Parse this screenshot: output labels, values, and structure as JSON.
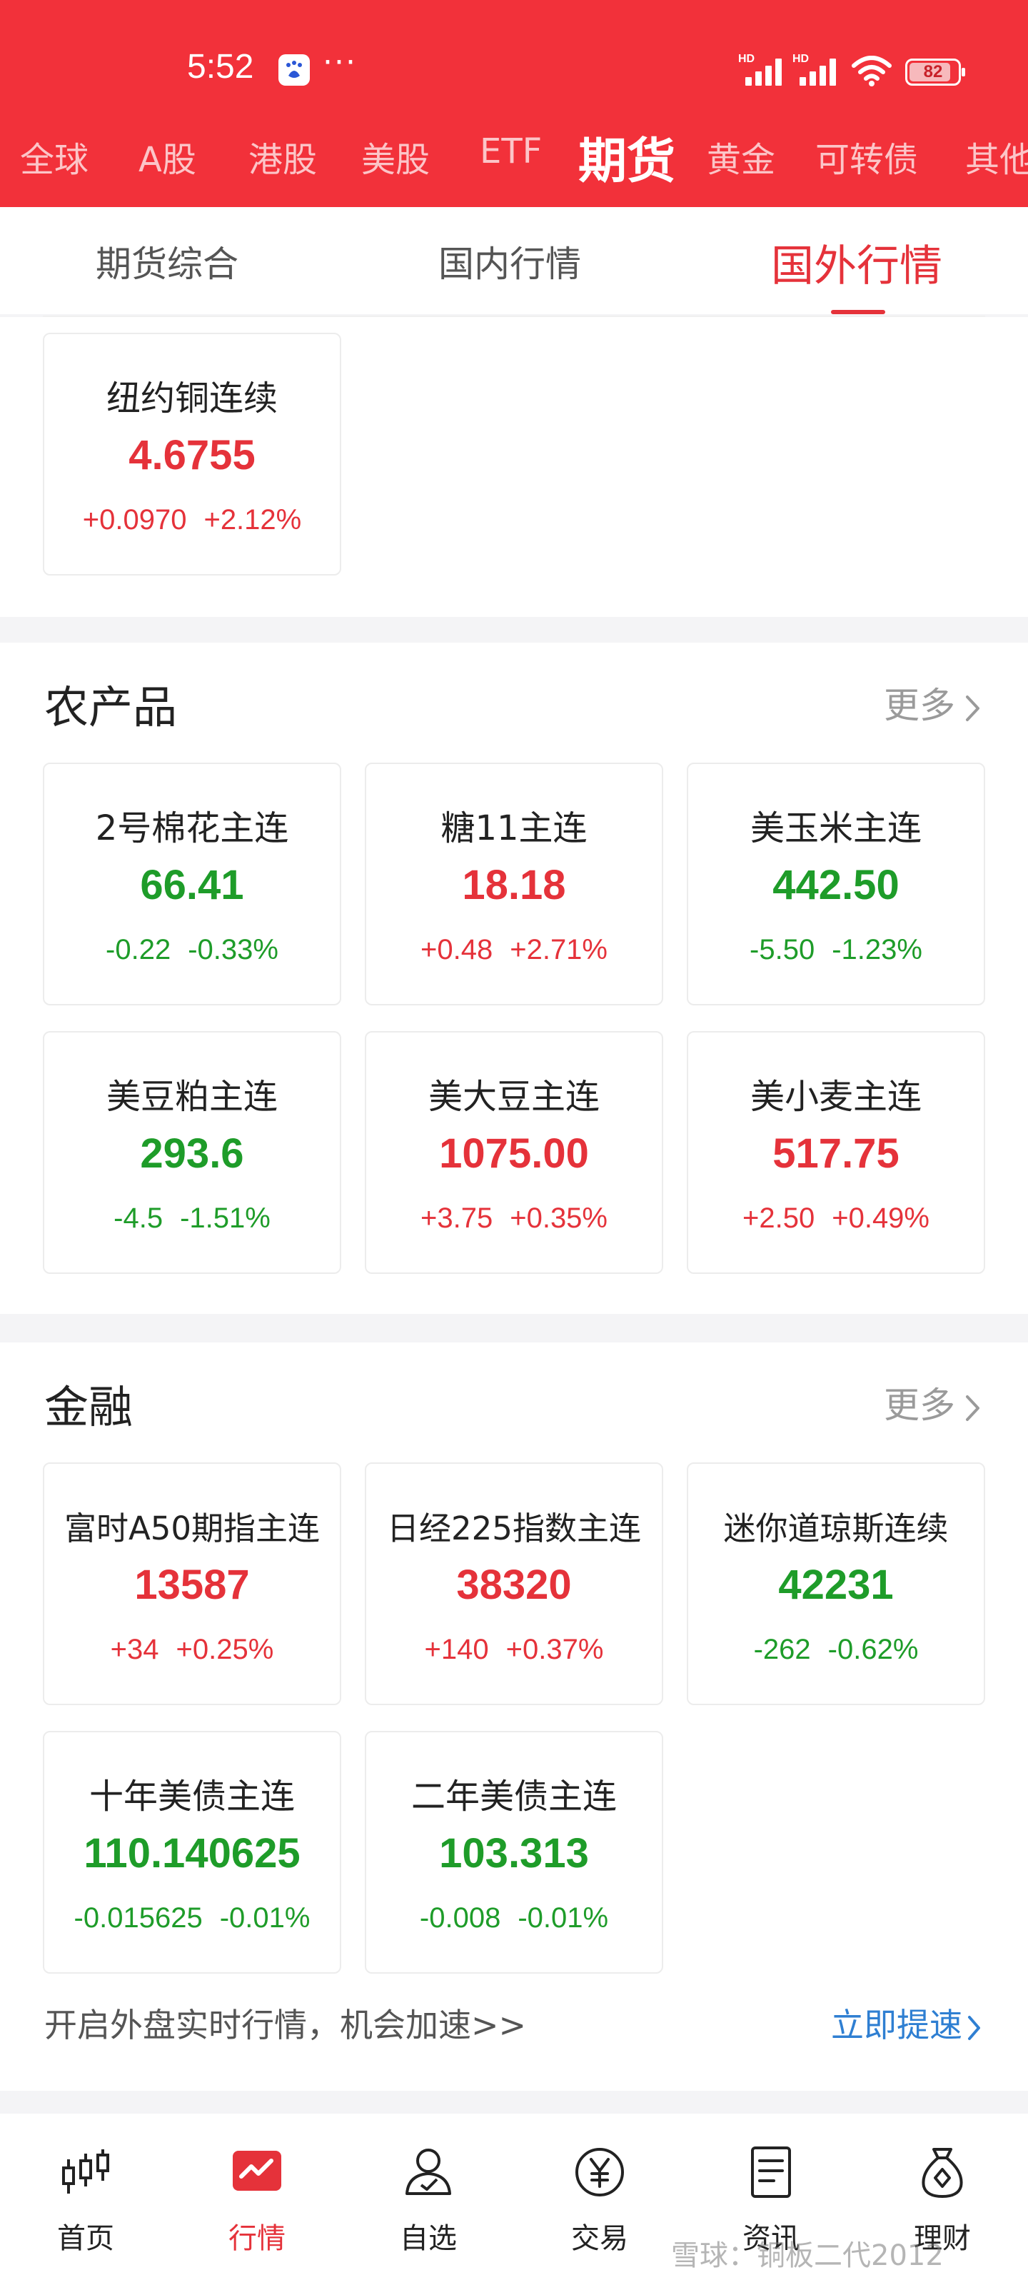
{
  "status_bar": {
    "time": "5:52",
    "more": "···",
    "signal1_label": "HD",
    "signal2_label": "HD",
    "battery": "82"
  },
  "market_tabs": [
    "全球",
    "A股",
    "港股",
    "美股",
    "ETF",
    "期货",
    "黄金",
    "可转债",
    "其他"
  ],
  "active_market_tab": "期货",
  "sub_tabs": [
    "期货综合",
    "国内行情",
    "国外行情"
  ],
  "active_sub_tab": "国外行情",
  "copper": {
    "name": "纽约铜连续",
    "price": "4.6755",
    "change": "+0.0970",
    "pct": "+2.12%",
    "trend": "up"
  },
  "agri": {
    "title": "农产品",
    "more": "更多",
    "items": [
      {
        "name": "2号棉花主连",
        "price": "66.41",
        "change": "-0.22",
        "pct": "-0.33%",
        "trend": "down"
      },
      {
        "name": "糖11主连",
        "price": "18.18",
        "change": "+0.48",
        "pct": "+2.71%",
        "trend": "up"
      },
      {
        "name": "美玉米主连",
        "price": "442.50",
        "change": "-5.50",
        "pct": "-1.23%",
        "trend": "down"
      },
      {
        "name": "美豆粕主连",
        "price": "293.6",
        "change": "-4.5",
        "pct": "-1.51%",
        "trend": "down"
      },
      {
        "name": "美大豆主连",
        "price": "1075.00",
        "change": "+3.75",
        "pct": "+0.35%",
        "trend": "up"
      },
      {
        "name": "美小麦主连",
        "price": "517.75",
        "change": "+2.50",
        "pct": "+0.49%",
        "trend": "up"
      }
    ]
  },
  "finance": {
    "title": "金融",
    "more": "更多",
    "items": [
      {
        "name": "富时A50期指主连",
        "price": "13587",
        "change": "+34",
        "pct": "+0.25%",
        "trend": "up"
      },
      {
        "name": "日经225指数主连",
        "price": "38320",
        "change": "+140",
        "pct": "+0.37%",
        "trend": "up"
      },
      {
        "name": "迷你道琼斯连续",
        "price": "42231",
        "change": "-262",
        "pct": "-0.62%",
        "trend": "down"
      },
      {
        "name": "十年美债主连",
        "price": "110.140625",
        "change": "-0.015625",
        "pct": "-0.01%",
        "trend": "down"
      },
      {
        "name": "二年美债主连",
        "price": "103.313",
        "change": "-0.008",
        "pct": "-0.01%",
        "trend": "down"
      }
    ],
    "promo_text": "开启外盘实时行情，机会加速>>",
    "promo_link": "立即提速"
  },
  "bottom_nav": [
    {
      "label": "首页",
      "icon": "candlestick-icon"
    },
    {
      "label": "行情",
      "icon": "market-chart-icon"
    },
    {
      "label": "自选",
      "icon": "user-watchlist-icon"
    },
    {
      "label": "交易",
      "icon": "yen-coin-icon"
    },
    {
      "label": "资讯",
      "icon": "document-icon"
    },
    {
      "label": "理财",
      "icon": "money-bag-icon"
    }
  ],
  "active_nav": "行情",
  "watermark": "雪球：铜板二代2012",
  "colors": {
    "header_red": "#f2313a",
    "up_red": "#e5323a",
    "down_green": "#1e9c29",
    "link_blue": "#2f7fd2"
  }
}
